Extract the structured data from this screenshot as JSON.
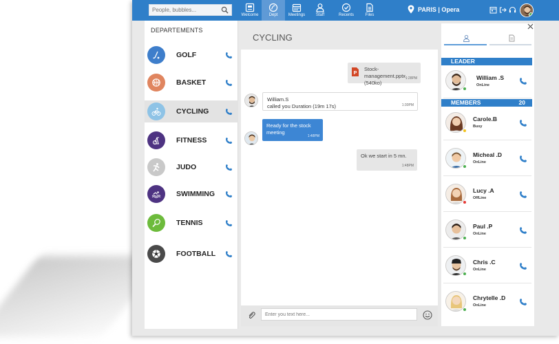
{
  "search": {
    "placeholder": "People, bubbles..."
  },
  "nav": [
    {
      "label": "Welcome",
      "icon": "welcome-icon"
    },
    {
      "label": "Dept",
      "icon": "dept-icon",
      "active": true
    },
    {
      "label": "Meetings",
      "icon": "calendar-icon"
    },
    {
      "label": "Staff",
      "icon": "staff-icon"
    },
    {
      "label": "Recents",
      "icon": "recents-icon"
    },
    {
      "label": "Files",
      "icon": "files-icon"
    }
  ],
  "location": {
    "text": "PARIS | Opera",
    "icon": "location-pin-icon"
  },
  "departments": {
    "header": "DEPARTEMENTS",
    "items": [
      {
        "label": "GOLF",
        "color": "#3e7ecb",
        "icon": "golf-icon"
      },
      {
        "label": "BASKET",
        "color": "#e0855f",
        "icon": "basketball-icon"
      },
      {
        "label": "CYCLING",
        "color": "#8ec3e6",
        "icon": "cycling-icon",
        "active": true
      },
      {
        "label": "FITNESS",
        "color": "#4e3382",
        "icon": "fitness-icon"
      },
      {
        "label": "JUDO",
        "color": "#c9c9c9",
        "icon": "judo-icon"
      },
      {
        "label": "SWIMMING",
        "color": "#4e3382",
        "icon": "swimming-icon"
      },
      {
        "label": "TENNIS",
        "color": "#6dbb3c",
        "icon": "tennis-icon"
      },
      {
        "label": "FOOTBALL",
        "color": "#4a4a4a",
        "icon": "football-icon"
      }
    ]
  },
  "chat": {
    "title": "CYCLING",
    "messages": [
      {
        "text": "Stock-management.pptx",
        "sub": "(540ko)",
        "time": "1:28PM"
      },
      {
        "sender": "William.S",
        "text": "called you Duration (19m 17s)",
        "time": "1:30PM"
      },
      {
        "text": "Ready for the stock meeting",
        "time": "1:48PM"
      },
      {
        "text": "Ok we start in 5 mn.",
        "time": "1:48PM"
      }
    ],
    "composer_placeholder": "Enter you text here..."
  },
  "members_panel": {
    "leader_label": "LEADER",
    "members_label": "MEMBERS",
    "members_count": "20",
    "leader": {
      "name": "William .S",
      "status": "OnLine",
      "status_color": "#4caf50"
    },
    "members": [
      {
        "name": "Carole.B",
        "status": "Busy",
        "status_color": "#f2c21b"
      },
      {
        "name": "Micheal .D",
        "status": "OnLine",
        "status_color": "#4caf50"
      },
      {
        "name": "Lucy .A",
        "status": "OffLine",
        "status_color": "#e53935"
      },
      {
        "name": "Paul .P",
        "status": "OnLine",
        "status_color": "#4caf50"
      },
      {
        "name": "Chris .C",
        "status": "OnLine",
        "status_color": "#4caf50"
      },
      {
        "name": "Chrytelle .D",
        "status": "OnLine",
        "status_color": "#4caf50"
      }
    ]
  },
  "colors": {
    "primary": "#2f7fc9",
    "accent": "#3d86d4"
  }
}
